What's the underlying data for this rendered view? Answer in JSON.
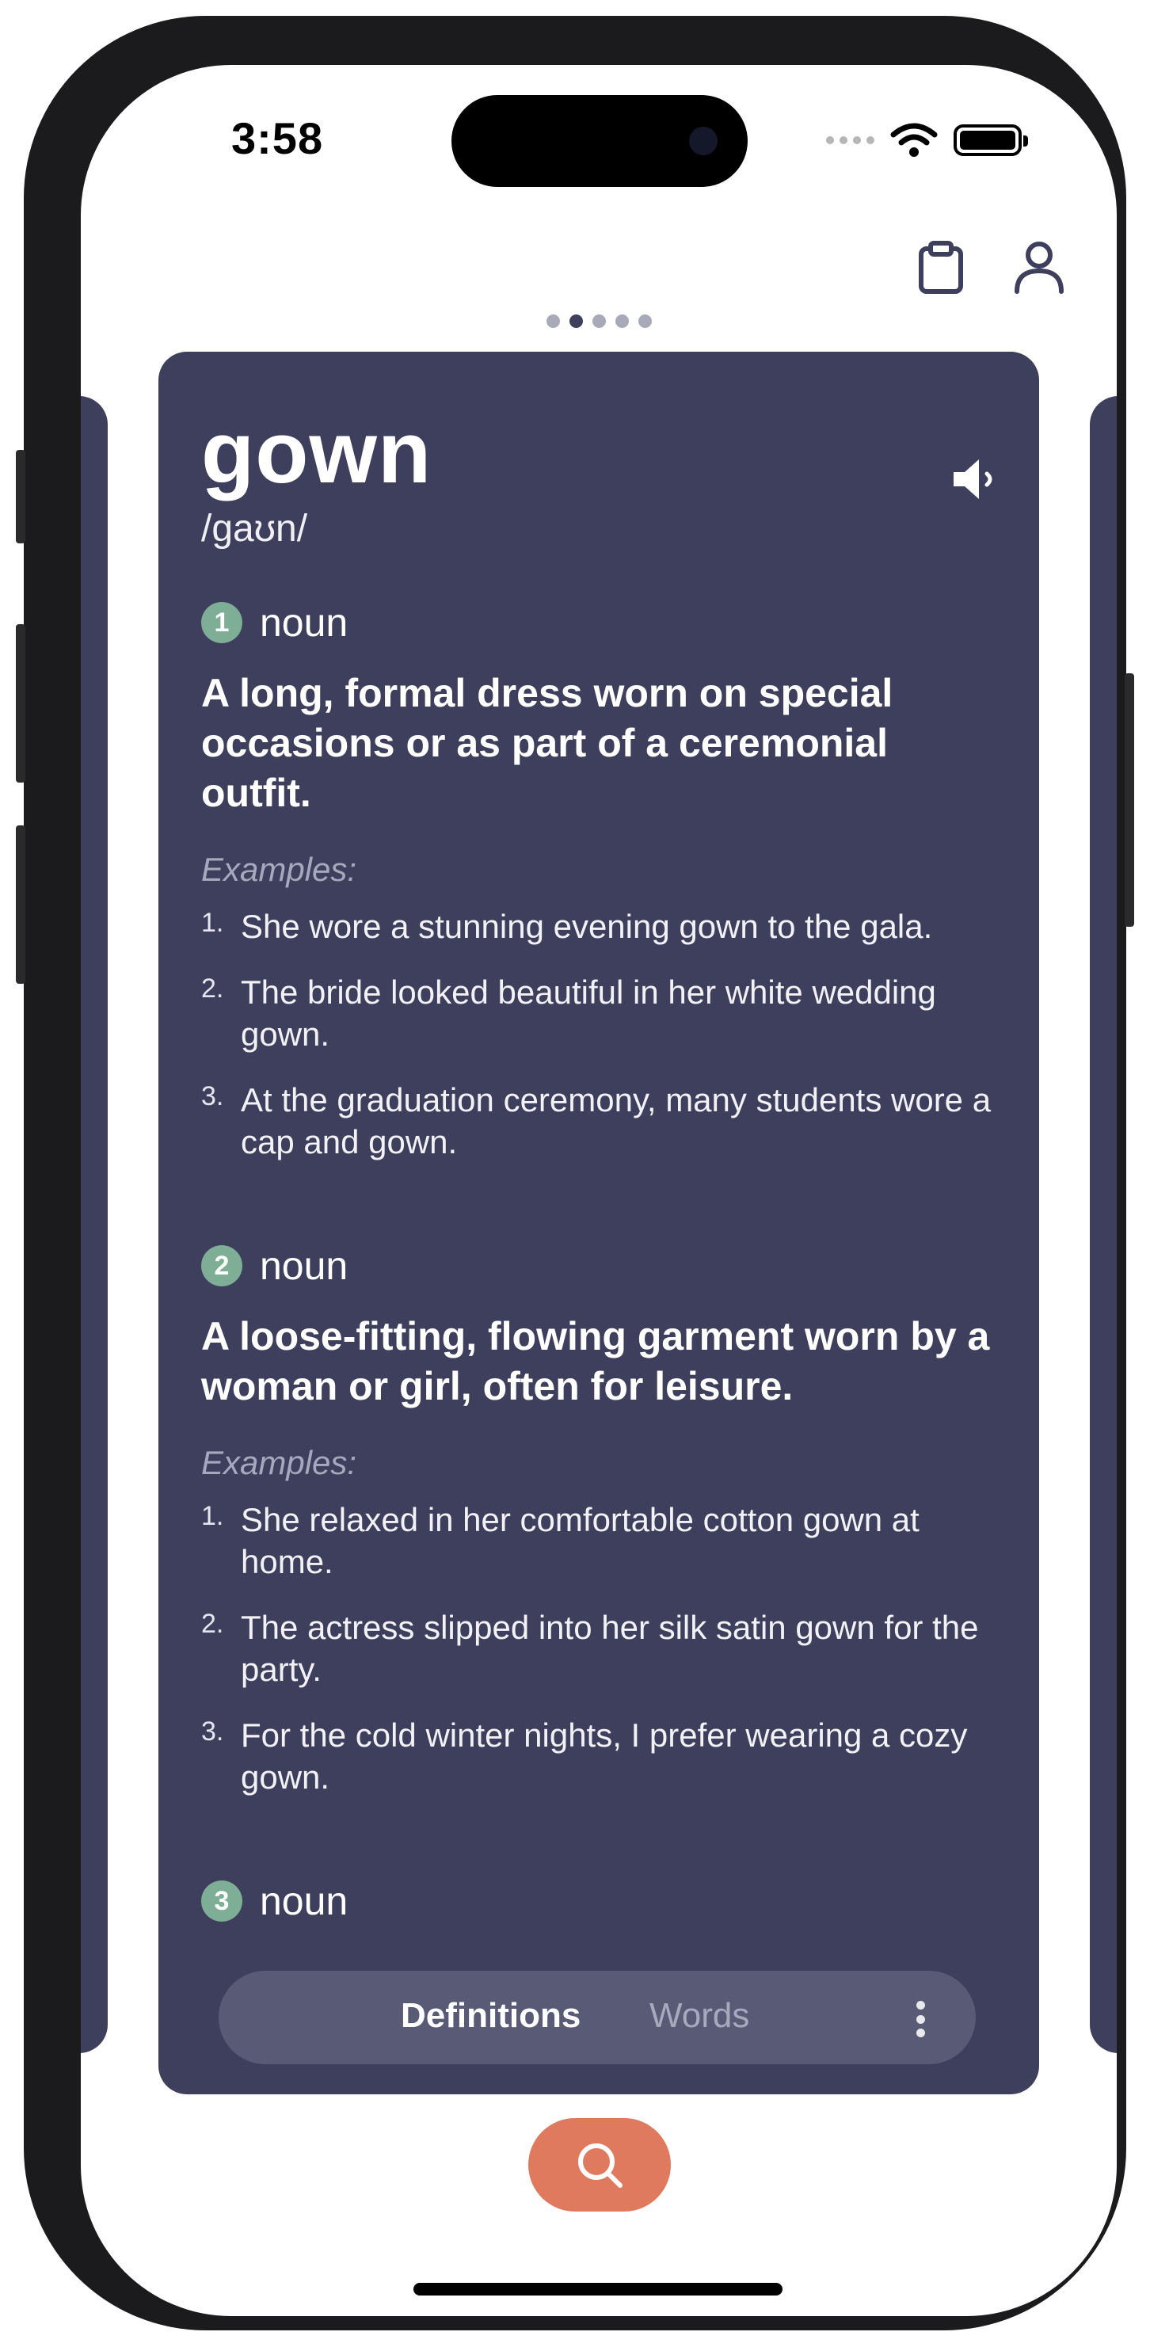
{
  "status_bar": {
    "time": "3:58",
    "icons": [
      "signal-dots-icon",
      "wifi-icon",
      "battery-icon"
    ]
  },
  "top_bar": {
    "icons": [
      "clipboard-icon",
      "user-icon"
    ]
  },
  "pager": {
    "count": 5,
    "active_index": 1
  },
  "entry": {
    "word": "gown",
    "phonetic": "/gaʊn/",
    "audio_icon": "speaker-icon",
    "senses": [
      {
        "number": "1",
        "pos": "noun",
        "definition": "A long, formal dress worn on special occasions or as part of a ceremonial outfit.",
        "examples_label": "Examples:",
        "examples": [
          {
            "n": "1.",
            "text": "She wore a stunning evening gown to the gala."
          },
          {
            "n": "2.",
            "text": "The bride looked beautiful in her white wedding gown."
          },
          {
            "n": "3.",
            "text": "At the graduation ceremony, many students wore a cap and gown."
          }
        ]
      },
      {
        "number": "2",
        "pos": "noun",
        "definition": "A loose-fitting, flowing garment worn by a woman or girl, often for leisure.",
        "examples_label": "Examples:",
        "examples": [
          {
            "n": "1.",
            "text": "She relaxed in her comfortable cotton gown at home."
          },
          {
            "n": "2.",
            "text": "The actress slipped into her silk satin gown for the party."
          },
          {
            "n": "3.",
            "text": "For the cold winter nights, I prefer wearing a cozy gown."
          }
        ]
      },
      {
        "number": "3",
        "pos": "noun"
      }
    ]
  },
  "bottom_tabs": {
    "definitions": "Definitions",
    "words": "Words",
    "active": "Definitions",
    "more_icon": "more-vertical-icon"
  },
  "fab": {
    "icon": "search-icon"
  },
  "colors": {
    "card": "#3e3f5c",
    "accent": "#e07a5f",
    "sense_badge": "#7fae96",
    "tab_bar": "#595a75"
  }
}
